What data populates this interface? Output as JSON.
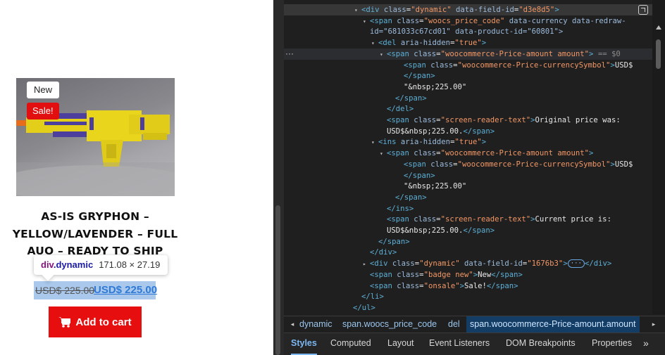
{
  "shop": {
    "badge_new": "New",
    "badge_sale": "Sale!",
    "title": "AS-IS GRYPHON – YELLOW/LAVENDER – FULL AUO – READY TO SHIP",
    "title_lines": [
      "AS-IS GRYPHON –",
      "YELLOW/LAVENDER – FULL",
      "AUO – READY TO SHIP"
    ],
    "price_old": "USD$ 225.00",
    "price_new": "USD$ 225.00",
    "add_to_cart_label": "Add to cart",
    "cart_icon": "cart-icon",
    "colors": {
      "sale": "#e10f0f",
      "button": "#e60e0e",
      "price_link": "#2e7ad6",
      "highlight": "#a9c8ec"
    }
  },
  "inspect_tooltip": {
    "tag": "div",
    "class": ".dynamic",
    "dimensions": "171.08 × 27.19"
  },
  "devtools": {
    "code_lines": [
      {
        "indent": 9,
        "arrow": "▾",
        "pre": "",
        "tag": "div",
        "attrs": [
          [
            "class",
            "dynamic"
          ],
          [
            "data-field-id",
            "d3e8d5"
          ]
        ],
        "post": ">",
        "text": "",
        "suffix": "",
        "selected": true
      },
      {
        "indent": 10,
        "arrow": "▾",
        "pre": "",
        "tag": "span",
        "attrs": [
          [
            "class",
            "woocs_price_code"
          ],
          [
            "data-currency",
            ""
          ],
          [
            "data-redraw-",
            ""
          ]
        ],
        "post": "",
        "text": "",
        "suffix": ""
      },
      {
        "indent": 10,
        "arrow": "",
        "pre": "",
        "raw": "id=\"681033c67cd01\" data-product-id=\"60801\">"
      },
      {
        "indent": 11,
        "arrow": "▾",
        "pre": "",
        "tag": "del",
        "attrs": [
          [
            "aria-hidden",
            "true"
          ]
        ],
        "post": ">",
        "text": "",
        "suffix": ""
      },
      {
        "indent": 12,
        "arrow": "▾",
        "pre": "",
        "tag": "span",
        "attrs": [
          [
            "class",
            "woocommerce-Price-amount amount"
          ]
        ],
        "post": ">",
        "text": "",
        "suffix": " == $0",
        "hover": true
      },
      {
        "indent": 14,
        "arrow": "",
        "pre": "",
        "tag": "span",
        "attrs": [
          [
            "class",
            "woocommerce-Price-currencySymbol"
          ]
        ],
        "post": ">",
        "text": "USD$",
        "suffix": ""
      },
      {
        "indent": 14,
        "arrow": "",
        "raw_close": "</span>"
      },
      {
        "indent": 14,
        "arrow": "",
        "raw_text": "\"&nbsp;225.00\""
      },
      {
        "indent": 13,
        "arrow": "",
        "raw_close": "</span>"
      },
      {
        "indent": 12,
        "arrow": "",
        "raw_close": "</del>"
      },
      {
        "indent": 12,
        "arrow": "",
        "pre": "",
        "tag": "span",
        "attrs": [
          [
            "class",
            "screen-reader-text"
          ]
        ],
        "post": ">",
        "text": "Original price was:",
        "suffix": ""
      },
      {
        "indent": 12,
        "arrow": "",
        "raw_mixed": [
          "USD$&nbsp;225.00.",
          "</span>"
        ]
      },
      {
        "indent": 11,
        "arrow": "▾",
        "pre": "",
        "tag": "ins",
        "attrs": [
          [
            "aria-hidden",
            "true"
          ]
        ],
        "post": ">",
        "text": "",
        "suffix": ""
      },
      {
        "indent": 12,
        "arrow": "▾",
        "pre": "",
        "tag": "span",
        "attrs": [
          [
            "class",
            "woocommerce-Price-amount amount"
          ]
        ],
        "post": ">",
        "text": "",
        "suffix": ""
      },
      {
        "indent": 14,
        "arrow": "",
        "pre": "",
        "tag": "span",
        "attrs": [
          [
            "class",
            "woocommerce-Price-currencySymbol"
          ]
        ],
        "post": ">",
        "text": "USD$",
        "suffix": ""
      },
      {
        "indent": 14,
        "arrow": "",
        "raw_close": "</span>"
      },
      {
        "indent": 14,
        "arrow": "",
        "raw_text": "\"&nbsp;225.00\""
      },
      {
        "indent": 13,
        "arrow": "",
        "raw_close": "</span>"
      },
      {
        "indent": 12,
        "arrow": "",
        "raw_close": "</ins>"
      },
      {
        "indent": 12,
        "arrow": "",
        "pre": "",
        "tag": "span",
        "attrs": [
          [
            "class",
            "screen-reader-text"
          ]
        ],
        "post": ">",
        "text": "Current price is:",
        "suffix": ""
      },
      {
        "indent": 12,
        "arrow": "",
        "raw_mixed": [
          "USD$&nbsp;225.00.",
          "</span>"
        ]
      },
      {
        "indent": 11,
        "arrow": "",
        "raw_close": "</span>"
      },
      {
        "indent": 10,
        "arrow": "",
        "raw_close": "</div>"
      },
      {
        "indent": 10,
        "arrow": "▸",
        "pre": "",
        "tag": "div",
        "attrs": [
          [
            "class",
            "dynamic"
          ],
          [
            "data-field-id",
            "1676b3"
          ]
        ],
        "post": ">",
        "text": "",
        "suffix": "",
        "ellipsis": "···",
        "tail": "</div>"
      },
      {
        "indent": 10,
        "arrow": "",
        "pre": "",
        "tag": "span",
        "attrs": [
          [
            "class",
            "badge new"
          ]
        ],
        "post": ">",
        "text": "New",
        "suffix": "",
        "tail": "</span>"
      },
      {
        "indent": 10,
        "arrow": "",
        "pre": "",
        "tag": "span",
        "attrs": [
          [
            "class",
            "onsale"
          ]
        ],
        "post": ">",
        "text": "Sale!",
        "suffix": "",
        "tail": "</span>"
      },
      {
        "indent": 9,
        "arrow": "",
        "raw_close": "</li>"
      },
      {
        "indent": 8,
        "arrow": "",
        "raw_close": "</ul>"
      }
    ],
    "breadcrumbs": [
      "dynamic",
      "span.woocs_price_code",
      "del",
      "span.woocommerce-Price-amount.amount"
    ],
    "tabs": [
      "Styles",
      "Computed",
      "Layout",
      "Event Listeners",
      "DOM Breakpoints",
      "Properties"
    ],
    "active_tab": "Styles",
    "more_label": "»"
  }
}
